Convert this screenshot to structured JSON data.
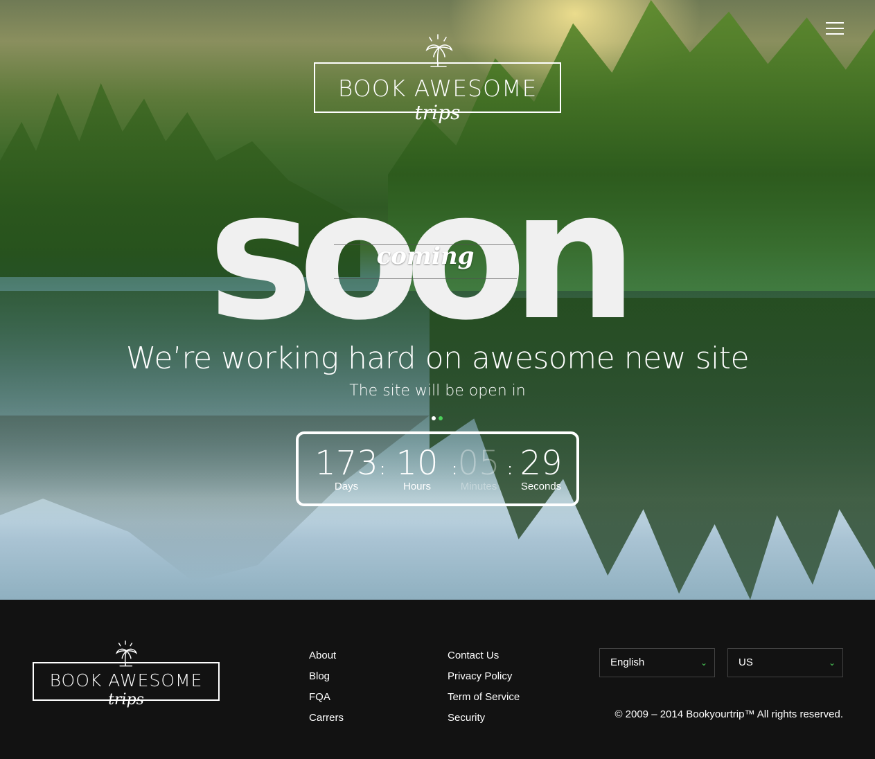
{
  "brand": {
    "name": "BOOK AWESOME",
    "tagline": "trips"
  },
  "hero": {
    "big_word": "soon",
    "overlay_word": "coming",
    "headline": "We’re working hard on awesome new site",
    "subline": "The site will be open in"
  },
  "countdown": [
    {
      "value": "173",
      "label": "Days"
    },
    {
      "value": "10",
      "label": "Hours"
    },
    {
      "value": "05",
      "label": "Minutes"
    },
    {
      "value": "29",
      "label": "Seconds"
    }
  ],
  "countdown_separator": ":",
  "footer": {
    "links_col1": [
      "About",
      "Blog",
      "FQA",
      "Carrers"
    ],
    "links_col2": [
      "Contact Us",
      "Privacy Policy",
      "Term of Service",
      "Security"
    ],
    "language_select": "English",
    "country_select": "US",
    "copyright": "© 2009 – 2014 Bookyourtrip™ All rights reserved."
  },
  "icons": {
    "menu": "hamburger-menu-icon",
    "logo": "palm-tree-icon",
    "select": "chevron-down-icon"
  },
  "colors": {
    "accent": "#4cd15a",
    "footer_bg": "#121212",
    "text": "#ffffff"
  }
}
